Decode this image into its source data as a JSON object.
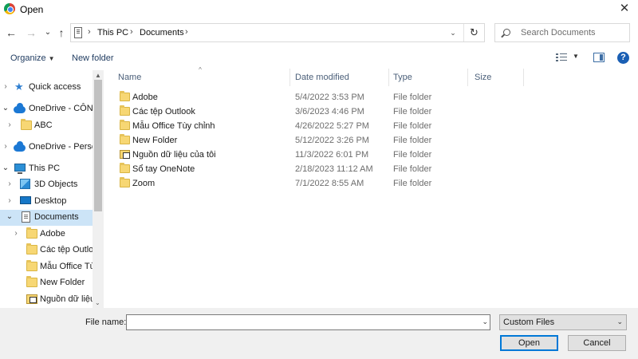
{
  "window": {
    "title": "Open",
    "close_glyph": "✕"
  },
  "nav_buttons": {
    "back": "←",
    "forward": "→",
    "recent": "⌄",
    "up": "↑"
  },
  "address": {
    "crumbs": [
      "This PC",
      "Documents"
    ],
    "separator": "›",
    "dropdown": "⌄",
    "refresh": "↻"
  },
  "search": {
    "placeholder": "Search Documents"
  },
  "toolbar": {
    "organize_label": "Organize",
    "organize_caret": "▼",
    "new_folder_label": "New folder",
    "view_caret": "▼",
    "help": "?"
  },
  "navpane": {
    "items": [
      {
        "label": "Quick access",
        "icon": "star-icon",
        "chevron": "›"
      },
      {
        "label": "OneDrive - CÔNG",
        "icon": "cloud-icon",
        "chevron": "⌄"
      },
      {
        "label": "ABC",
        "icon": "folder-icon",
        "chevron": "›"
      },
      {
        "label": "OneDrive - Persor",
        "icon": "cloud-icon",
        "chevron": "›"
      },
      {
        "label": "This PC",
        "icon": "computer-icon",
        "chevron": "⌄"
      },
      {
        "label": "3D Objects",
        "icon": "3d-objects-icon",
        "chevron": "›"
      },
      {
        "label": "Desktop",
        "icon": "desktop-icon",
        "chevron": "›"
      },
      {
        "label": "Documents",
        "icon": "documents-icon",
        "chevron": "⌄",
        "selected": true
      },
      {
        "label": "Adobe",
        "icon": "folder-icon",
        "chevron": "›"
      },
      {
        "label": "Các tệp Outloc",
        "icon": "folder-icon",
        "chevron": ""
      },
      {
        "label": "Mẫu Office Tùy",
        "icon": "folder-icon",
        "chevron": ""
      },
      {
        "label": "New Folder",
        "icon": "folder-icon",
        "chevron": ""
      },
      {
        "label": "Nguồn dữ liệu",
        "icon": "shortcut-folder-icon",
        "chevron": ""
      }
    ],
    "scroll_up": "▲",
    "scroll_down": "⌄"
  },
  "columns": {
    "name": "Name",
    "date": "Date modified",
    "type": "Type",
    "size": "Size",
    "sort_arrow": "^"
  },
  "files": [
    {
      "name": "Adobe",
      "date": "5/4/2022 3:53 PM",
      "type": "File folder",
      "icon": "folder-icon"
    },
    {
      "name": "Các tệp Outlook",
      "date": "3/6/2023 4:46 PM",
      "type": "File folder",
      "icon": "folder-icon"
    },
    {
      "name": "Mẫu Office Tùy chỉnh",
      "date": "4/26/2022 5:27 PM",
      "type": "File folder",
      "icon": "folder-icon"
    },
    {
      "name": "New Folder",
      "date": "5/12/2022 3:26 PM",
      "type": "File folder",
      "icon": "folder-icon"
    },
    {
      "name": "Nguồn dữ liệu của tôi",
      "date": "11/3/2022 6:01 PM",
      "type": "File folder",
      "icon": "shortcut-folder-icon"
    },
    {
      "name": "Sổ tay OneNote",
      "date": "2/18/2023 11:12 AM",
      "type": "File folder",
      "icon": "folder-icon"
    },
    {
      "name": "Zoom",
      "date": "7/1/2022 8:55 AM",
      "type": "File folder",
      "icon": "folder-icon"
    }
  ],
  "footer": {
    "file_name_label": "File name:",
    "file_name_value": "",
    "file_name_dropdown": "⌄",
    "filter_value": "Custom Files",
    "filter_dropdown": "⌄",
    "open_label": "Open",
    "cancel_label": "Cancel"
  },
  "colors": {
    "selected_bg": "#cce4f7",
    "accent": "#0078d7",
    "folder": "#f7d774",
    "header_text": "#4c607a"
  }
}
